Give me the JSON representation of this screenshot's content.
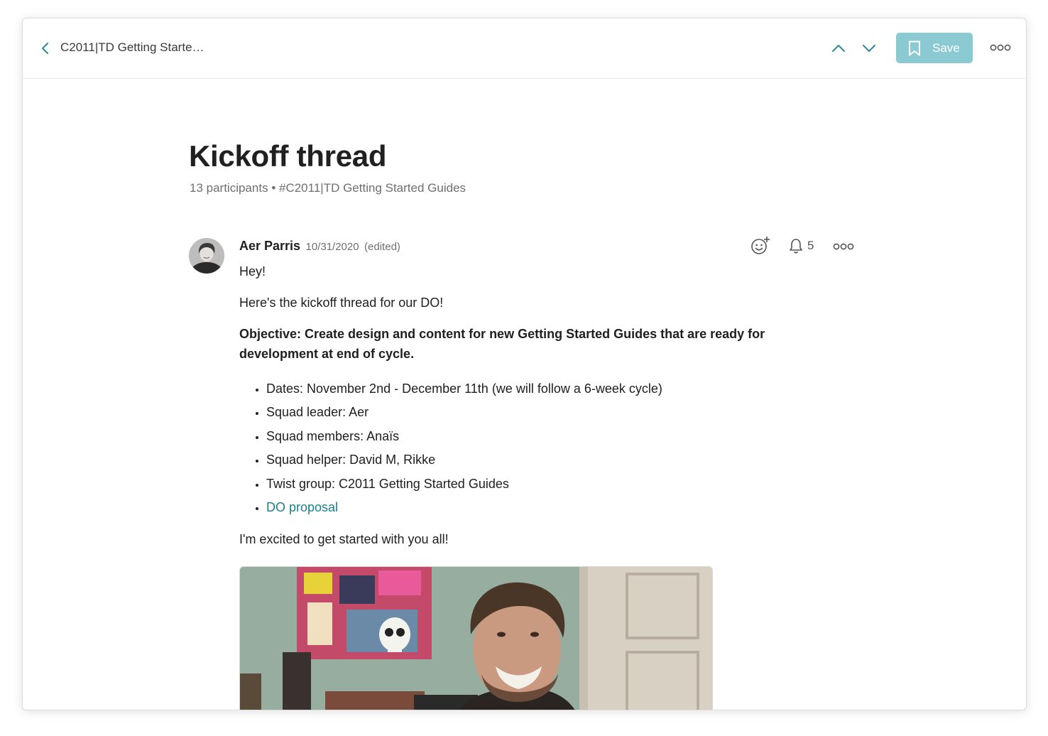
{
  "topbar": {
    "breadcrumb": "C2011|TD Getting Starte…",
    "save_label": "Save",
    "save_color": "#8ccad3",
    "icons": [
      "chevron-left-icon",
      "chevron-up-icon",
      "chevron-down-icon",
      "bookmark-icon",
      "more-horizontal-icon"
    ]
  },
  "thread": {
    "title": "Kickoff thread",
    "participants": "13 participants",
    "separator": "•",
    "channel": "#C2011|TD Getting Started Guides"
  },
  "message": {
    "author": "Aer Parris",
    "date": "10/31/2020",
    "edited": "(edited)",
    "notification_count": "5",
    "greeting": "Hey!",
    "intro": "Here's the kickoff thread for our DO!",
    "objective": "Objective: Create design and content for new Getting Started Guides that are ready for development at end of cycle.",
    "bullets": [
      "Dates: November 2nd - December 11th (we will follow a 6-week cycle)",
      "Squad leader: Aer",
      "Squad members: Anaïs",
      "Squad helper: David M, Rikke",
      "Twist group: C2011 Getting Started Guides"
    ],
    "link_text": "DO proposal",
    "link_color": "#1a7f8c",
    "outro": "I'm excited to get started with you all!"
  }
}
